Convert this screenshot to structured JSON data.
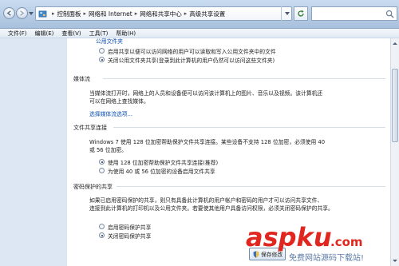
{
  "address_bar": {
    "crumbs": [
      "控制面板",
      "网络和 Internet",
      "网络和共享中心",
      "高级共享设置"
    ]
  },
  "menu": [
    "文件(F)",
    "编辑(E)",
    "查看(V)",
    "工具(T)",
    "帮助(H)"
  ],
  "content": {
    "top_link": "公用文件夹",
    "public_folder": {
      "options": [
        {
          "label": "启用共享以便可以访问网络的用户可以读取和写入公用文件夹中的文件",
          "checked": false
        },
        {
          "label": "关闭公用文件夹共享(登录到此计算机的用户仍然可以访问这些文件夹)",
          "checked": true
        }
      ]
    },
    "media": {
      "title": "媒体流",
      "desc_line1": "当媒体流打开时，网络上的人员和设备便可以访问该计算机上的图片、音乐以及视频。该计算机还",
      "desc_line2": "可以在网络上查找媒体。",
      "link": "选择媒体流选项..."
    },
    "file_sharing": {
      "title": "文件共享连接",
      "desc_line1": "Windows 7 使用 128 位加密帮助保护文件共享连接。某些设备不支持 128 位加密，必须使用 40",
      "desc_line2": "或 56 位加密。",
      "options": [
        {
          "label": "使用 128 位加密帮助保护文件共享连接(推荐)",
          "checked": true
        },
        {
          "label": "为使用 40 或 56 位加密的设备启用文件共享",
          "checked": false
        }
      ]
    },
    "password": {
      "title": "密码保护的共享",
      "desc_line1": "如果已启用密码保护的共享，则只有具备此计算机的用户帐户和密码的用户才可以访问共享文件、",
      "desc_line2": "连接到此计算机的打印机以及公用文件夹。若要使其他用户具备访问权限，必须关闭密码保护的共享。",
      "options": [
        {
          "label": "启用密码保护共享",
          "checked": false
        },
        {
          "label": "关闭密码保护共享",
          "checked": true
        }
      ]
    }
  },
  "buttons": {
    "save": "保存修改"
  },
  "watermark": {
    "brand": "aspku",
    "suffix": ".com",
    "sub": "免费网站源码下载站!"
  },
  "colors": {
    "link": "#0b4fb3",
    "watermark_red": "#e0261e"
  }
}
